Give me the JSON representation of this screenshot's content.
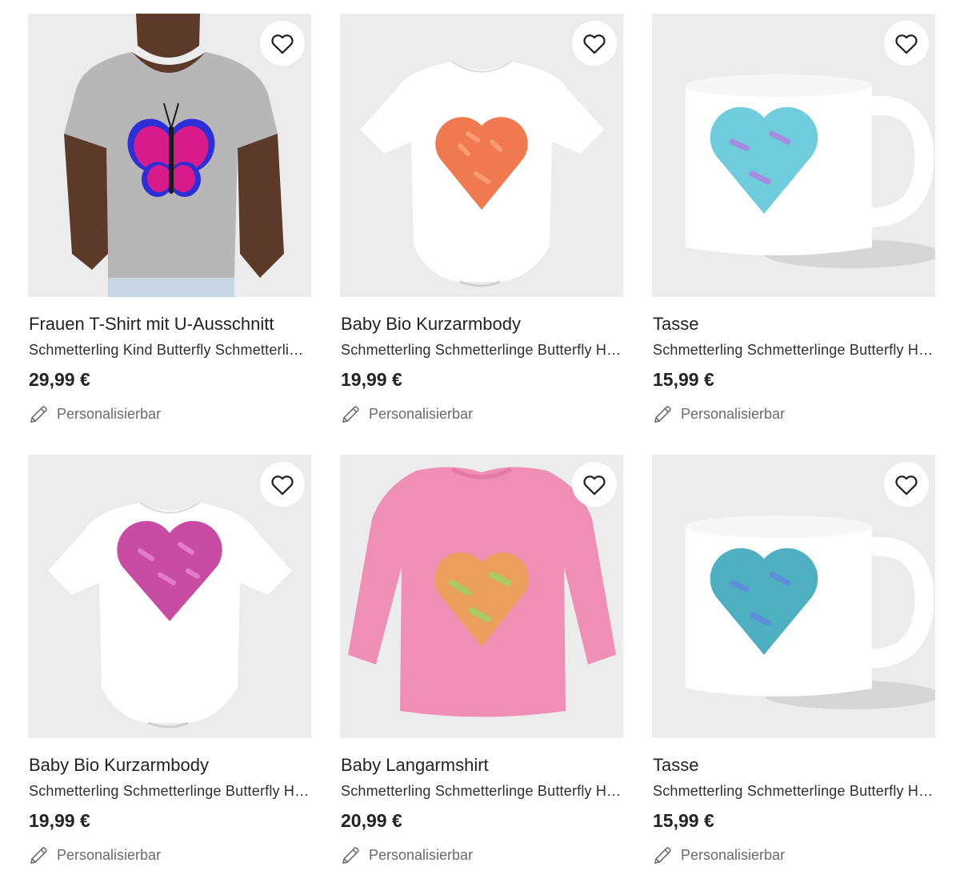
{
  "products": [
    {
      "title": "Frauen T-Shirt mit U-Ausschnitt",
      "subtitle": "Schmetterling Kind Butterfly Schmetterlinge",
      "price": "29,99 €",
      "personalize": "Personalisierbar",
      "image": "womens-tshirt-butterfly",
      "colors": {
        "product": "#b9b9b9",
        "motif": "#d81b8a"
      }
    },
    {
      "title": "Baby Bio Kurzarmbody",
      "subtitle": "Schmetterling Schmetterlinge Butterfly Herz",
      "price": "19,99 €",
      "personalize": "Personalisierbar",
      "image": "baby-body-heart",
      "colors": {
        "product": "#ffffff",
        "motif": "#f06a3c"
      }
    },
    {
      "title": "Tasse",
      "subtitle": "Schmetterling Schmetterlinge Butterfly Herz",
      "price": "15,99 €",
      "personalize": "Personalisierbar",
      "image": "mug-heart",
      "colors": {
        "product": "#ffffff",
        "motif": "#5fc7d9"
      }
    },
    {
      "title": "Baby Bio Kurzarmbody",
      "subtitle": "Schmetterling Schmetterlinge Butterfly Herz",
      "price": "19,99 €",
      "personalize": "Personalisierbar",
      "image": "baby-body-heart",
      "colors": {
        "product": "#ffffff",
        "motif": "#c2379a"
      }
    },
    {
      "title": "Baby Langarmshirt",
      "subtitle": "Schmetterling Schmetterlinge Butterfly Herz",
      "price": "20,99 €",
      "personalize": "Personalisierbar",
      "image": "baby-longsleeve-heart",
      "colors": {
        "product": "#f08fb6",
        "motif": "#e9a24e"
      }
    },
    {
      "title": "Tasse",
      "subtitle": "Schmetterling Schmetterlinge Butterfly Herz",
      "price": "15,99 €",
      "personalize": "Personalisierbar",
      "image": "mug-heart",
      "colors": {
        "product": "#ffffff",
        "motif": "#3aa6b9"
      }
    }
  ],
  "icons": {
    "favorite": "heart-outline-icon",
    "personalize": "pencil-icon"
  }
}
